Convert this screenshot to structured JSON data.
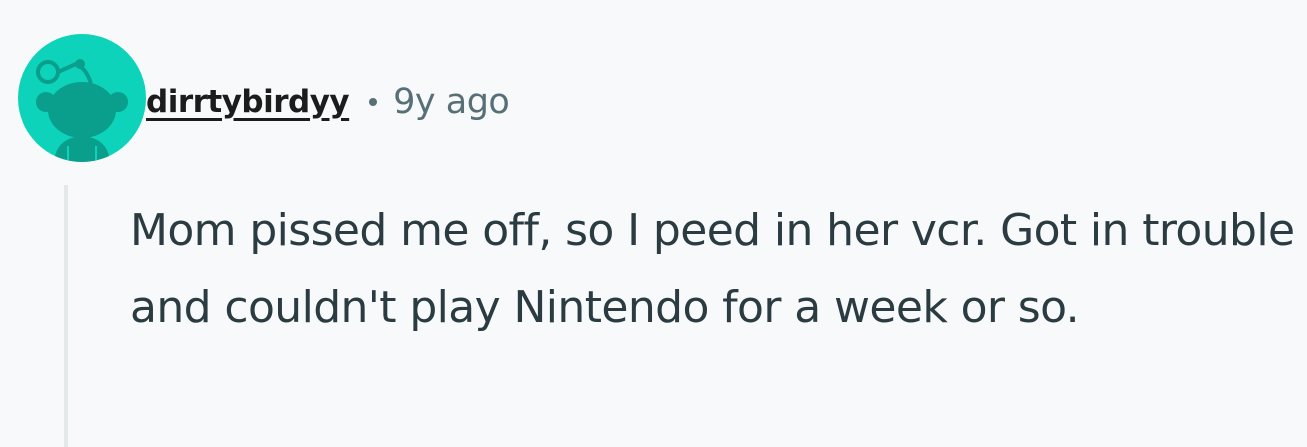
{
  "comment": {
    "author": "dirrtybirdyy",
    "timestamp": "9y ago",
    "body": "Mom pissed me off, so I peed in her vcr. Got in trouble and couldn't play Nintendo for a week or so.",
    "avatar_icon": "snoo-default-avatar-icon",
    "colors": {
      "avatar_bg": "#0dd3bb",
      "avatar_figure": "#0a9e8c",
      "username": "#1c1c1c",
      "meta": "#576f76",
      "body": "#2a3c42",
      "thread_line": "#e3e8eb",
      "page_bg": "#f7f9fa"
    }
  }
}
